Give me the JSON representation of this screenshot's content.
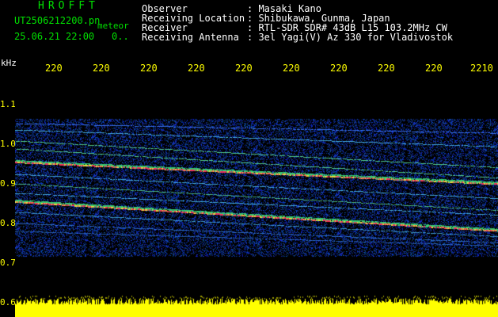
{
  "header": {
    "app_title": "HROFFT",
    "file_name": "UT2506212200.pn",
    "mode": "meteor",
    "datetime": "25.06.21 22:00",
    "truncated_value": "0.."
  },
  "station": {
    "rows": [
      {
        "label": "Observer",
        "value": ": Masaki Kano"
      },
      {
        "label": "Receiving Location",
        "value": ": Shibukawa, Gunma, Japan"
      },
      {
        "label": "Receiver",
        "value": ": RTL-SDR SDR# 43dB L15 103.2MHz CW"
      },
      {
        "label": "Receiving Antenna",
        "value": ": 3el Yagi(V) Az 330 for Vladivostok"
      }
    ]
  },
  "axis": {
    "y_unit": "kHz",
    "x_ticks": [
      "220",
      "220",
      "220",
      "220",
      "220",
      "220",
      "220",
      "220",
      "220",
      "2210"
    ],
    "y_ticks": [
      "1.1",
      "1.0",
      "0.9",
      "0.8",
      "0.7",
      "0.6"
    ]
  },
  "colors": {
    "header_green": "#00e000",
    "tick_yellow": "#ffff00",
    "text_white": "#ffffff",
    "background": "#000000",
    "noise_blue": "#1030c0",
    "signal_green": "#30e070",
    "signal_red": "#ff2050",
    "floor_yellow": "#ffff00"
  }
}
